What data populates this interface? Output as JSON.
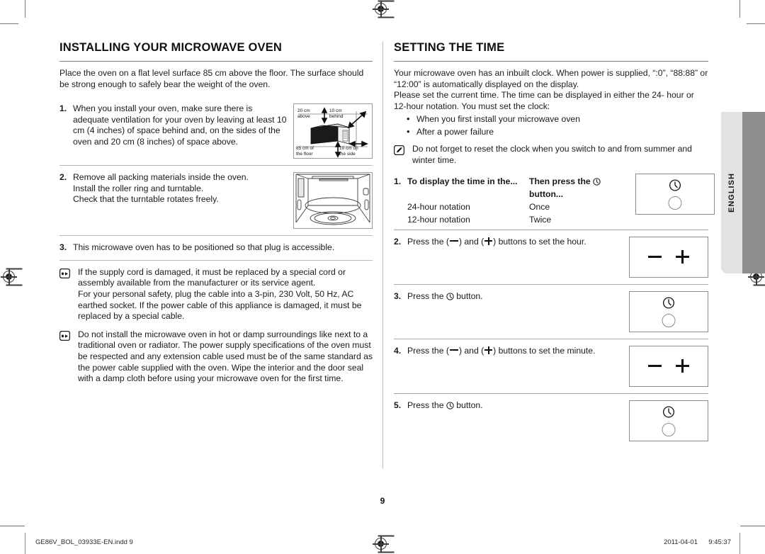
{
  "document": {
    "page_number": "9",
    "language_tab": "ENGLISH",
    "footer": {
      "file_name": "GE86V_BOL_03933E-EN.indd   9",
      "date": "2011-04-01",
      "time": "9:45:37"
    }
  },
  "left_column": {
    "title": "INSTALLING YOUR MICROWAVE OVEN",
    "intro": "Place the oven on a flat level surface 85 cm above the floor. The surface should be strong enough to safely bear the weight of the oven.",
    "steps": [
      {
        "number": "1.",
        "text": "When you install your oven, make sure there is adequate ventilation for your oven by leaving at least 10 cm (4 inches) of space behind and, on the sides of the oven and 20 cm (8 inches) of space above.",
        "illustration": "ventilation-clearance-diagram",
        "illustration_labels": {
          "above": "20 cm",
          "above_sub": "above",
          "behind": "10 cm",
          "behind_sub": "behind",
          "floor": "85 cm of",
          "floor_sub": "the floor",
          "side": "10 cm on",
          "side_sub": "the side"
        }
      },
      {
        "number": "2.",
        "text": "Remove all packing materials inside the oven.\nInstall the roller ring and turntable.\nCheck that the turntable rotates freely.",
        "illustration": "oven-cavity-turntable-diagram"
      },
      {
        "number": "3.",
        "text": "This microwave oven has to be positioned so that plug is accessible."
      }
    ],
    "notes": [
      {
        "icon": "pointing-hand-icon",
        "text": "If the supply cord is damaged, it must be replaced by a special cord or assembly available from the manufacturer or its service agent.\nFor your personal safety, plug the cable into a 3-pin, 230 Volt, 50 Hz, AC earthed socket. If the power cable of this appliance is damaged, it must be replaced by a special cable."
      },
      {
        "icon": "pointing-hand-icon",
        "text": "Do not install the microwave oven in hot or damp surroundings like next to a traditional oven or radiator. The power supply specifications of the oven must be respected and any extension cable used must be of the same standard as the power cable supplied with the oven. Wipe the interior and the door seal with a damp cloth before using your microwave oven for the first time."
      }
    ]
  },
  "right_column": {
    "title": "SETTING THE TIME",
    "intro_1": "Your microwave oven has an inbuilt clock. When power is supplied, “:0”, “88:88” or “12:00” is automatically displayed on the display.",
    "intro_2": "Please set the current time. The time can be displayed in either the 24- hour or 12-hour notation. You must set the clock:",
    "bullets": [
      "When you first install your microwave oven",
      "After a power failure"
    ],
    "note": {
      "icon": "pencil-note-icon",
      "text": "Do not forget to reset the clock when you switch to and from summer and winter time."
    },
    "steps": [
      {
        "number": "1.",
        "header_col1": "To display the time in the...",
        "header_col2_pre": "Then press the",
        "header_col2_post": "button...",
        "rows": [
          {
            "col1": "24-hour notation",
            "col2": "Once"
          },
          {
            "col1": "12-hour notation",
            "col2": "Twice"
          }
        ],
        "keypad": "clock-button-panel"
      },
      {
        "number": "2.",
        "text_pre": "Press the (",
        "text_mid": ") and (",
        "text_post": ") buttons to set the hour.",
        "keypad": "minus-plus-button-panel"
      },
      {
        "number": "3.",
        "text_pre": "Press the",
        "text_post": "button.",
        "keypad": "clock-button-panel"
      },
      {
        "number": "4.",
        "text_pre": "Press the (",
        "text_mid": ") and (",
        "text_post": ") buttons to set the minute.",
        "keypad": "minus-plus-button-panel"
      },
      {
        "number": "5.",
        "text_pre": "Press the",
        "text_post": "button.",
        "keypad": "clock-button-panel"
      }
    ]
  }
}
